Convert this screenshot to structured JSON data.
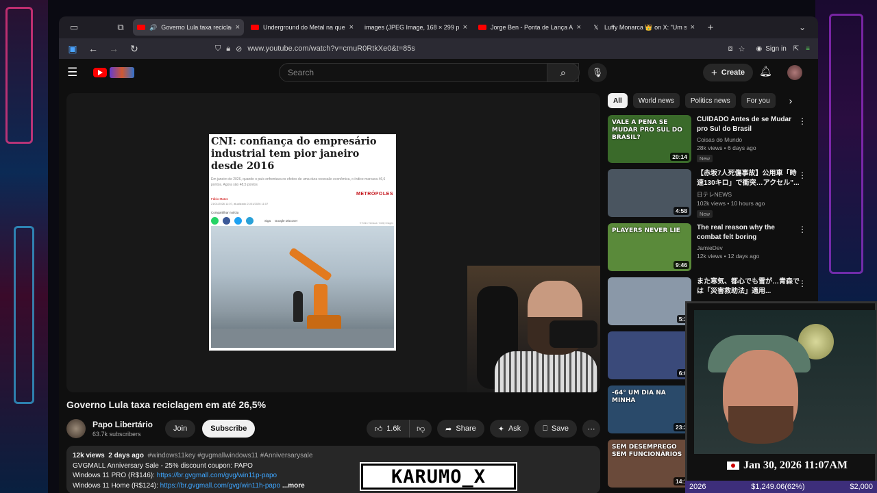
{
  "browser": {
    "tabs": [
      {
        "title": "Governo Lula taxa reciclage",
        "favicon": "youtube-icon",
        "active": true
      },
      {
        "title": "Underground do Metal na quebr",
        "favicon": "youtube-icon",
        "active": false
      },
      {
        "title": "images (JPEG Image, 168 × 299 pix",
        "favicon": "none",
        "active": false
      },
      {
        "title": "Jorge Ben - Ponta de Lança Afri",
        "favicon": "youtube-icon",
        "active": false
      },
      {
        "title": "Luffy Monarca 👑 on X: \"Um stra",
        "favicon": "x-icon",
        "active": false
      }
    ],
    "url": "www.youtube.com/watch?v=cmuR0RtkXe0&t=85s",
    "sign_in": "Sign in"
  },
  "youtube": {
    "search_placeholder": "Search",
    "create_label": "Create",
    "video": {
      "title": "Governo Lula taxa reciclagem em até 26,5%",
      "article_headline": "CNI: confiança do empresário industrial tem pior janeiro desde 2016",
      "article_sub": "Em janeiro de 2026, quando o país enfrentava os efeitos de uma dura recessão econômica, o índice marcava 46,6 pontos. Agora são 48,5 pontos",
      "article_author": "Fábio Matos",
      "article_meta": "21/01/2026 11:07, atualizado 21/01/2026 11:07",
      "article_brand": "METRÓPOLES",
      "article_share": "Compartilhar notícia",
      "article_follow": "Siga",
      "article_discover": "Google Discover",
      "article_credit": "© Shiro Yamaoa / Getty Images"
    },
    "channel": {
      "name": "Papo Libertário",
      "subscribers": "63.7k subscribers",
      "join_label": "Join",
      "subscribe_label": "Subscribe"
    },
    "actions": {
      "likes": "1.6k",
      "share": "Share",
      "ask": "Ask",
      "save": "Save"
    },
    "description": {
      "views": "12k views",
      "date": "2 days ago",
      "tags": "#windows11key #gvgmallwindows11 #Anniversarysale",
      "line1": "GVGMALL Anniversary Sale - 25% discount coupon: PAPO",
      "line2_label": "Windows 11 PRO (R$146):",
      "line2_link": "https://br.gvgmall.com/gvg/win11p-papo",
      "line3_label": "Windows 11 Home (R$124):",
      "line3_link": "https://br.gvgmall.com/gvg/win11h-papo",
      "more": "...more"
    },
    "chips": [
      "All",
      "World news",
      "Politics news",
      "For you"
    ],
    "recommendations": [
      {
        "title": "CUIDADO Antes de se Mudar pro Sul do Brasil",
        "channel": "Coisas do Mundo",
        "meta": "28k views • 6 days ago",
        "badge": "New",
        "duration": "20:14",
        "thumb_text": "VALE A PENA SE MUDAR PRO SUL DO BRASIL?",
        "thumb_color": "#3a6a2a"
      },
      {
        "title": "【赤坂7人死傷事故】公用車「時速130キロ」で衝突…アクセル”...",
        "channel": "日テレNEWS",
        "meta": "102k views • 10 hours ago",
        "badge": "New",
        "duration": "4:58",
        "thumb_text": "",
        "thumb_color": "#4a5560"
      },
      {
        "title": "The real reason why the combat felt boring",
        "channel": "JamieDev",
        "meta": "12k views • 12 days ago",
        "badge": "",
        "duration": "9:46",
        "thumb_text": "PLAYERS NEVER LIE",
        "thumb_color": "#5a8a3a"
      },
      {
        "title": "また寒気、都心でも雪が…青森では「災害救助法」適用...",
        "channel": "",
        "meta": "",
        "badge": "",
        "duration": "5:3",
        "thumb_text": "",
        "thumb_color": "#8a98a8"
      },
      {
        "title": "",
        "channel": "",
        "meta": "",
        "badge": "",
        "duration": "6:0",
        "thumb_text": "",
        "thumb_color": "#3a4a7a"
      },
      {
        "title": "",
        "channel": "",
        "meta": "",
        "badge": "",
        "duration": "23:3",
        "thumb_text": "-64° UM DIA NA MINHA",
        "thumb_color": "#2a4a6a"
      },
      {
        "title": "",
        "channel": "",
        "meta": "",
        "badge": "",
        "duration": "14:1",
        "thumb_text": "SEM DESEMPREGO SEM FUNCIONÁRIOS",
        "thumb_color": "#6a4a3a"
      }
    ]
  },
  "overlay": {
    "watermark": "KARUMO_X",
    "datetime": "Jan 30, 2026 11:07AM",
    "ticker_year": "2026",
    "ticker_value": "$1,249.06(62%)",
    "ticker_goal": "$2,000"
  },
  "colors": {
    "youtube_red": "#ff0000",
    "link_blue": "#3ea6ff",
    "bg": "#0f0f0f"
  }
}
